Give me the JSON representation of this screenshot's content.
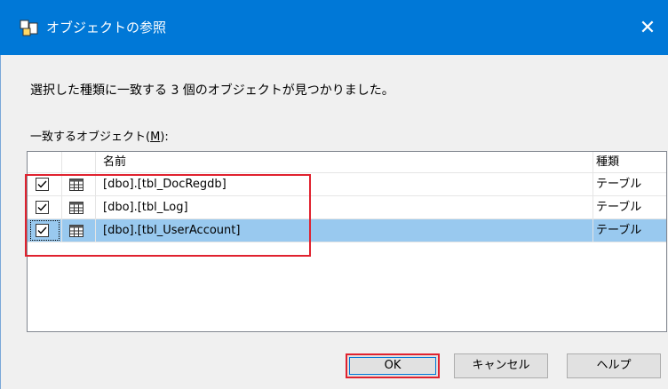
{
  "window": {
    "title": "オブジェクトの参照",
    "close_glyph": "✕",
    "accent_color": "#0078d7"
  },
  "message": "選択した種類に一致する 3 個のオブジェクトが見つかりました。",
  "list": {
    "label_prefix": "一致するオブジェクト(",
    "label_mnemonic": "M",
    "label_suffix": "):",
    "columns": {
      "name": "名前",
      "type": "種類"
    },
    "rows": [
      {
        "checked": true,
        "icon": "table-icon",
        "name": "[dbo].[tbl_DocRegdb]",
        "type": "テーブル",
        "selected": false
      },
      {
        "checked": true,
        "icon": "table-icon",
        "name": "[dbo].[tbl_Log]",
        "type": "テーブル",
        "selected": false
      },
      {
        "checked": true,
        "icon": "table-icon",
        "name": "[dbo].[tbl_UserAccount]",
        "type": "テーブル",
        "selected": true
      }
    ]
  },
  "buttons": {
    "ok": "OK",
    "cancel": "キャンセル",
    "help": "ヘルプ"
  },
  "colors": {
    "selection": "#99c9ef",
    "annotation_red": "#e0222f"
  }
}
